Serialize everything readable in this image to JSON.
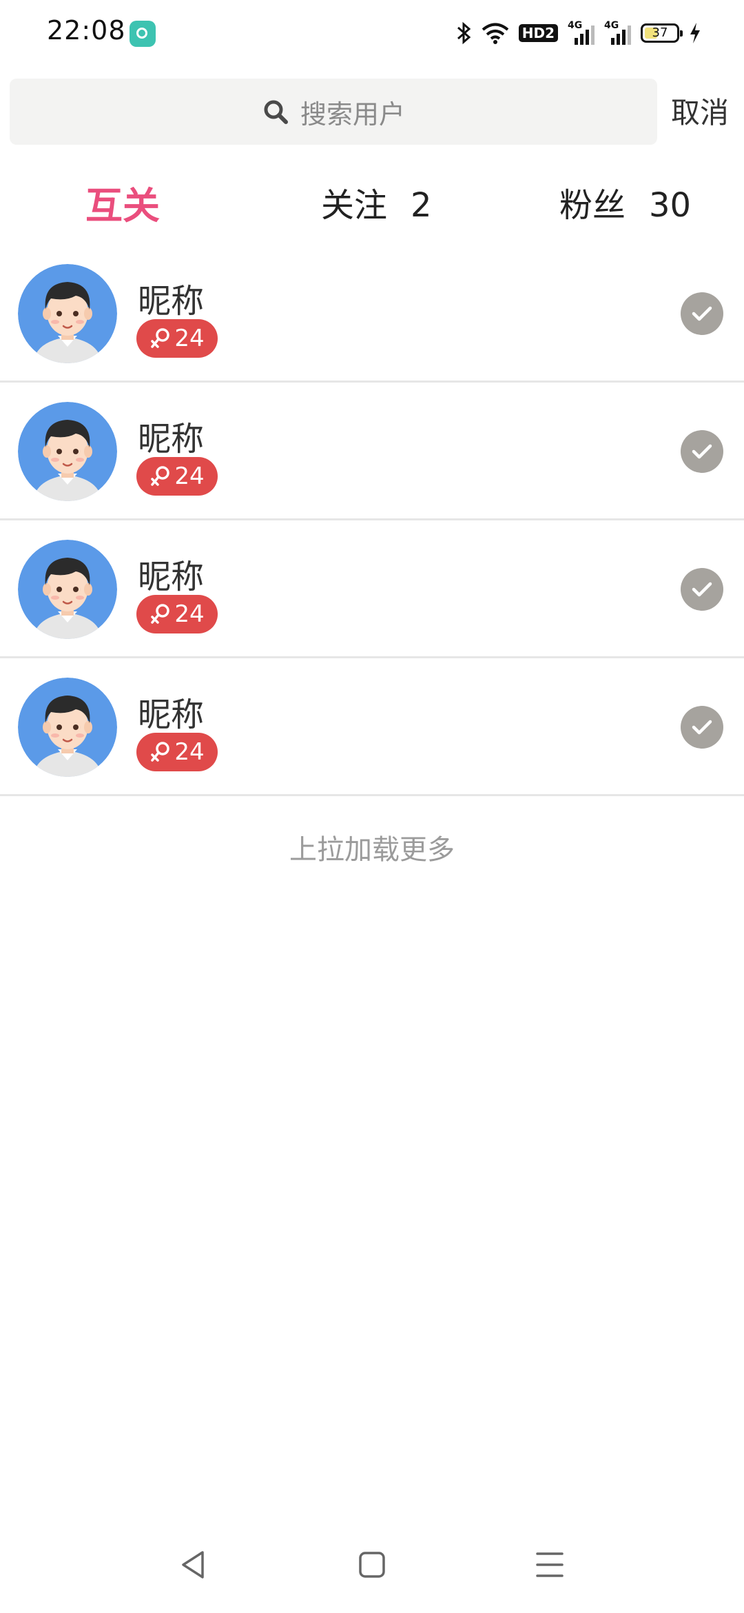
{
  "status_bar": {
    "time": "22:08",
    "battery": "37",
    "network_labels": [
      "4G",
      "4G"
    ],
    "hd_label": "HD2",
    "icons": [
      "app-notification-icon",
      "bluetooth-icon",
      "wifi-icon",
      "hd-icon",
      "signal-icon",
      "battery-icon",
      "charging-icon"
    ]
  },
  "search": {
    "placeholder": "搜索用户",
    "cancel_label": "取消",
    "icon": "search-icon"
  },
  "tabs": [
    {
      "label": "互关",
      "count": "",
      "active": true
    },
    {
      "label": "关注",
      "count": "2",
      "active": false
    },
    {
      "label": "粉丝",
      "count": "30",
      "active": false
    }
  ],
  "users": [
    {
      "nickname": "昵称",
      "age": "24",
      "gender_icon": "female-icon",
      "followed": true
    },
    {
      "nickname": "昵称",
      "age": "24",
      "gender_icon": "female-icon",
      "followed": true
    },
    {
      "nickname": "昵称",
      "age": "24",
      "gender_icon": "female-icon",
      "followed": true
    },
    {
      "nickname": "昵称",
      "age": "24",
      "gender_icon": "female-icon",
      "followed": true
    }
  ],
  "load_more": "上拉加载更多",
  "nav_bar": {
    "icons": [
      "back-icon",
      "home-icon",
      "menu-icon"
    ]
  },
  "colors": {
    "accent": "#ea4e7d",
    "badge": "#e04a4a",
    "check": "#a6a39e",
    "avatar_bg": "#5b9ae8",
    "search_bg": "#f3f3f2"
  }
}
